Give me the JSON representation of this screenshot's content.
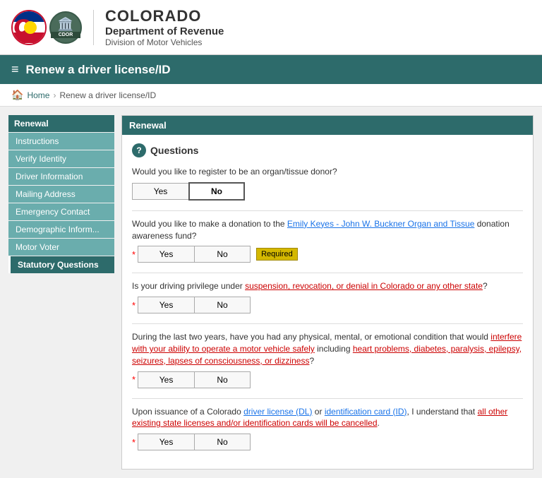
{
  "header": {
    "co_title": "COLORADO",
    "dept": "Department of Revenue",
    "div": "Division of Motor Vehicles"
  },
  "navbar": {
    "title": "Renew a driver license/ID",
    "hamburger": "≡"
  },
  "breadcrumb": {
    "home": "Home",
    "separator": "›",
    "current": "Renew a driver license/ID"
  },
  "sidebar": {
    "header": "Renewal",
    "items": [
      {
        "label": "Instructions",
        "state": "plain"
      },
      {
        "label": "Verify Identity",
        "plain": true
      },
      {
        "label": "Driver Information",
        "plain": true
      },
      {
        "label": "Mailing Address",
        "plain": true
      },
      {
        "label": "Emergency Contact",
        "plain": true
      },
      {
        "label": "Demographic Inform...",
        "plain": true
      },
      {
        "label": "Motor Voter",
        "plain": true
      },
      {
        "label": "Statutory Questions",
        "active": true
      }
    ]
  },
  "content": {
    "header": "Renewal",
    "questions_title": "Questions",
    "questions": [
      {
        "id": "q1",
        "text": "Would you like to register to be an organ/tissue donor?",
        "required": false,
        "selected": "No",
        "link": null
      },
      {
        "id": "q2",
        "text_before": "Would you like to make a donation to the ",
        "link_text": "Emily Keyes - John W. Buckner Organ and Tissue",
        "text_after": " donation awareness fund?",
        "required": true,
        "selected": null,
        "show_required_badge": true
      },
      {
        "id": "q3",
        "text": "Is your driving privilege under suspension, revocation, or denial in Colorado or any other state?",
        "required": true,
        "selected": null
      },
      {
        "id": "q4",
        "text": "During the last two years, have you had any physical, mental, or emotional condition that would interfere with your ability to operate a motor vehicle safely including heart problems, diabetes, paralysis, epilepsy, seizures, lapses of consciousness, or dizziness?",
        "required": true,
        "selected": null
      },
      {
        "id": "q5",
        "text_before": "Upon issuance of a Colorado driver license (DL) or identification card (ID), I understand that all other existing state licenses and/or identification cards will be cancelled.",
        "required": true,
        "selected": null,
        "emphasized_parts": [
          "driver license (DL)",
          "identification card (ID)",
          "all other existing state licenses and/or identification cards will be cancelled"
        ]
      }
    ],
    "yes_label": "Yes",
    "no_label": "No",
    "required_badge": "Required"
  }
}
